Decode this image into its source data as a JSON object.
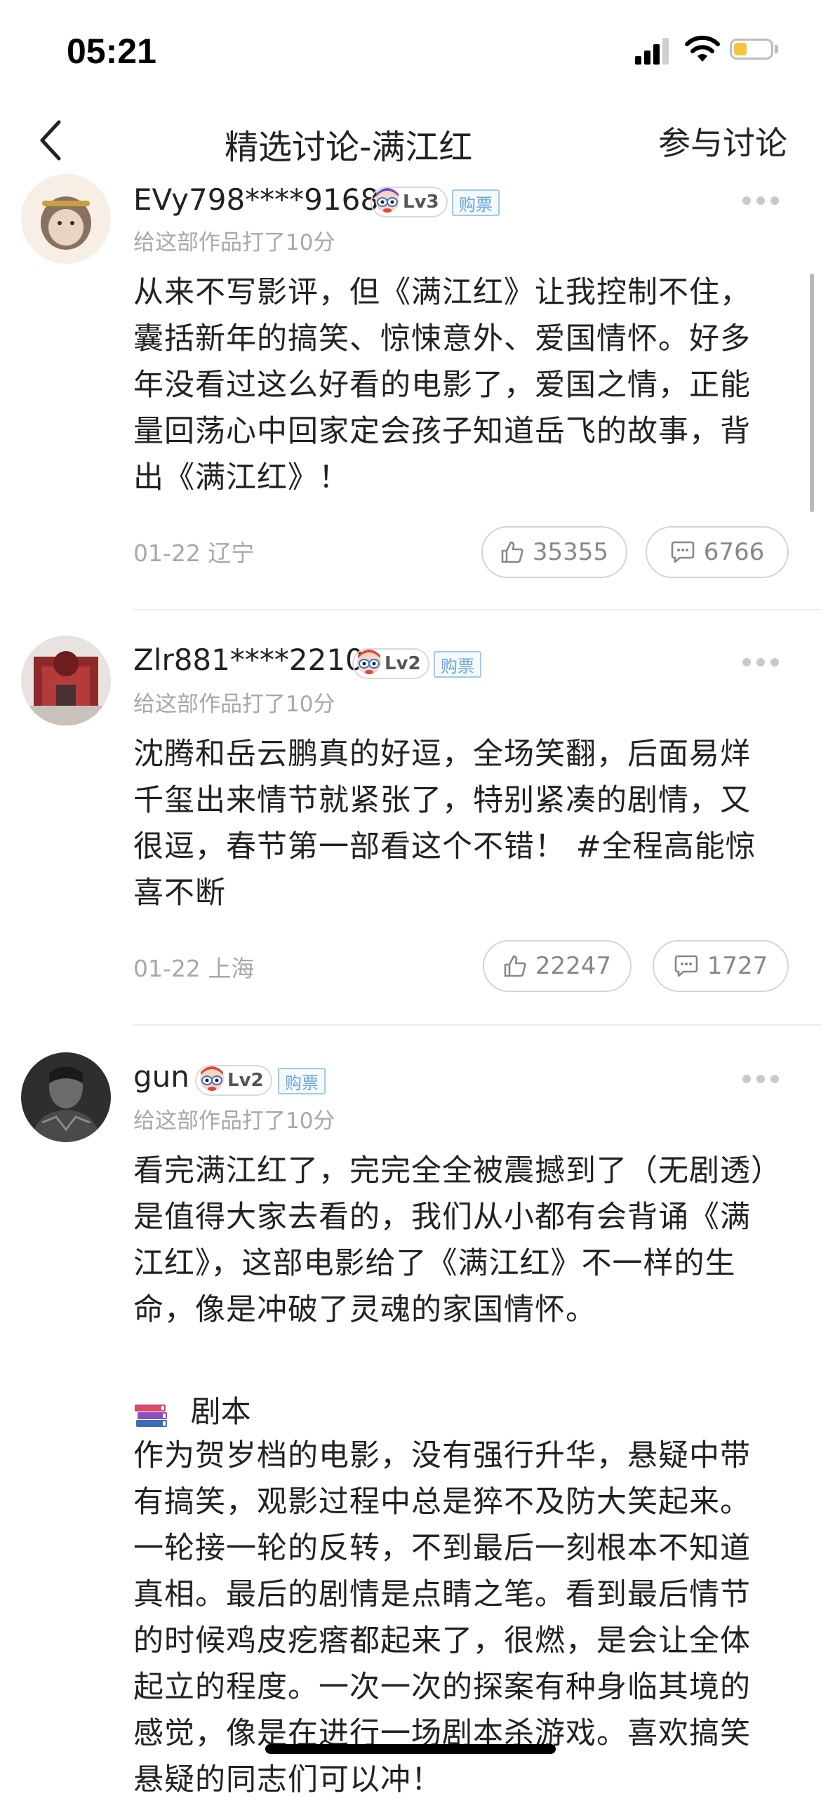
{
  "status_bar": {
    "time": "05:21"
  },
  "nav": {
    "title": "精选讨论-满江红",
    "action_label": "参与讨论"
  },
  "posts": [
    {
      "username": "EVy798****9168",
      "level": "Lv3",
      "ticket_tag": "购票",
      "rating": "给这部作品打了10分",
      "body": "从来不写影评，但《满江红》让我控制不住，囊括新年的搞笑、惊悚意外、爱国情怀。好多年没看过这么好看的电影了，爱国之情，正能量回荡心中回家定会孩子知道岳飞的故事，背出《满江红》！",
      "date_location": "01-22 辽宁",
      "likes": "35355",
      "comments": "6766"
    },
    {
      "username": "Zlr881****2210",
      "level": "Lv2",
      "ticket_tag": "购票",
      "rating": "给这部作品打了10分",
      "body": "沈腾和岳云鹏真的好逗，全场笑翻，后面易烊千玺出来情节就紧张了，特别紧凑的剧情，又很逗，春节第一部看这个不错！ #全程高能惊喜不断",
      "date_location": "01-22 上海",
      "likes": "22247",
      "comments": "1727"
    },
    {
      "username": "gun",
      "level": "Lv2",
      "ticket_tag": "购票",
      "rating": "给这部作品打了10分",
      "body": "看完满江红了，完完全全被震撼到了（无剧透）是值得大家去看的，我们从小都有会背诵《满江红》，这部电影给了《满江红》不一样的生命，像是冲破了灵魂的家国情怀。",
      "section_title": "剧本",
      "section_body": "作为贺岁档的电影，没有强行升华，悬疑中带有搞笑，观影过程中总是猝不及防大笑起来。一轮接一轮的反转，不到最后一刻根本不知道真相。最后的剧情是点睛之笔。看到最后情节的时候鸡皮疙瘩都起来了，很燃，是会让全体起立的程度。一次一次的探案有种身临其境的感觉，像是在进行一场剧本杀游戏。喜欢搞笑悬疑的同志们可以冲！"
    }
  ],
  "colors": {
    "accent_blue": "#6aa6d8",
    "muted_gray": "#a8a8a8",
    "battery_yellow": "#f6c43c"
  }
}
